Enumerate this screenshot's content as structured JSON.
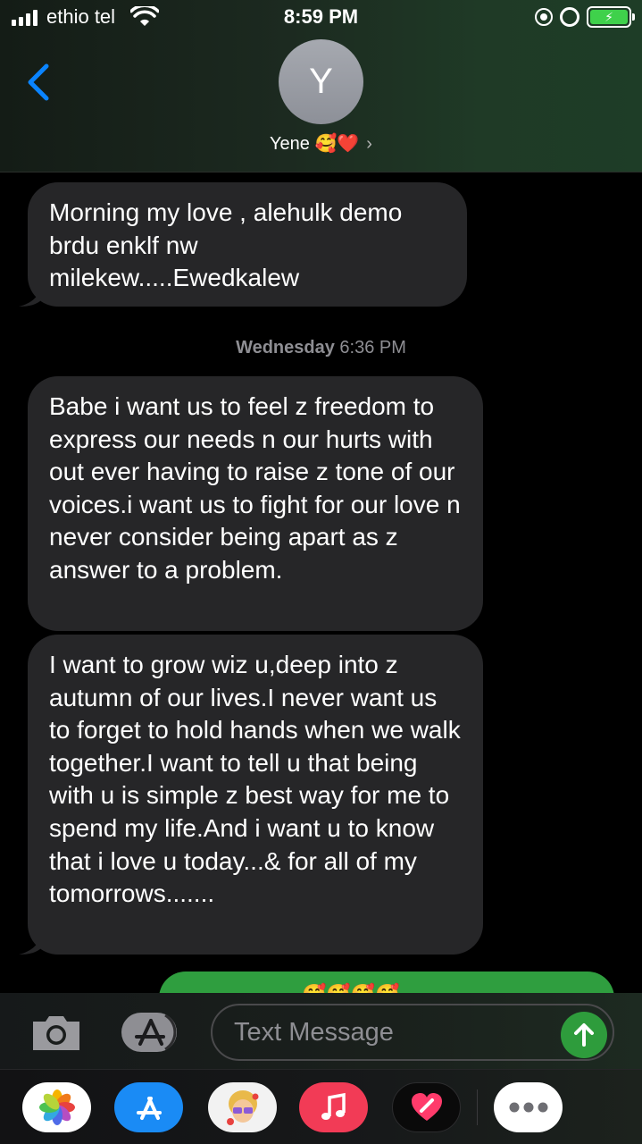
{
  "status_bar": {
    "carrier": "ethio tel",
    "time": "8:59 PM",
    "battery_icon": "battery-charging-icon"
  },
  "header": {
    "avatar_initial": "Y",
    "contact_name": "Yene 🥰❤️",
    "chevron": "›"
  },
  "messages": [
    {
      "direction": "incoming",
      "text": "Morning my love , alehulk demo brdu enklf nw milekew.....Ewedkalew"
    },
    {
      "direction": "incoming",
      "text": "Babe i want us to feel z freedom to express our needs n our hurts with out ever having to raise z tone of our voices.i want us to fight for our love n never consider being apart as z answer to a problem."
    },
    {
      "direction": "incoming",
      "text": "I want to grow wiz u,deep into z autumn of our lives.I never want us to forget to hold hands when we walk together.I want to tell u that being with u is simple z best way for me to spend my life.And i want u to know that i love u today...& for all of my tomorrows......."
    }
  ],
  "timestamp": {
    "day": "Wednesday",
    "time": "6:36 PM"
  },
  "outgoing_preview": {
    "emojis": "🥰🥰🥰🥰"
  },
  "input": {
    "placeholder": "Text Message"
  },
  "colors": {
    "incoming_bubble": "#262628",
    "outgoing_bubble": "#2f9e3f",
    "accent_blue": "#0a84ff",
    "send_green": "#2e9c3c"
  },
  "app_drawer": [
    "photos-icon",
    "app-store-icon",
    "memoji-icon",
    "music-icon",
    "fitness-heart-icon",
    "more-icon"
  ]
}
